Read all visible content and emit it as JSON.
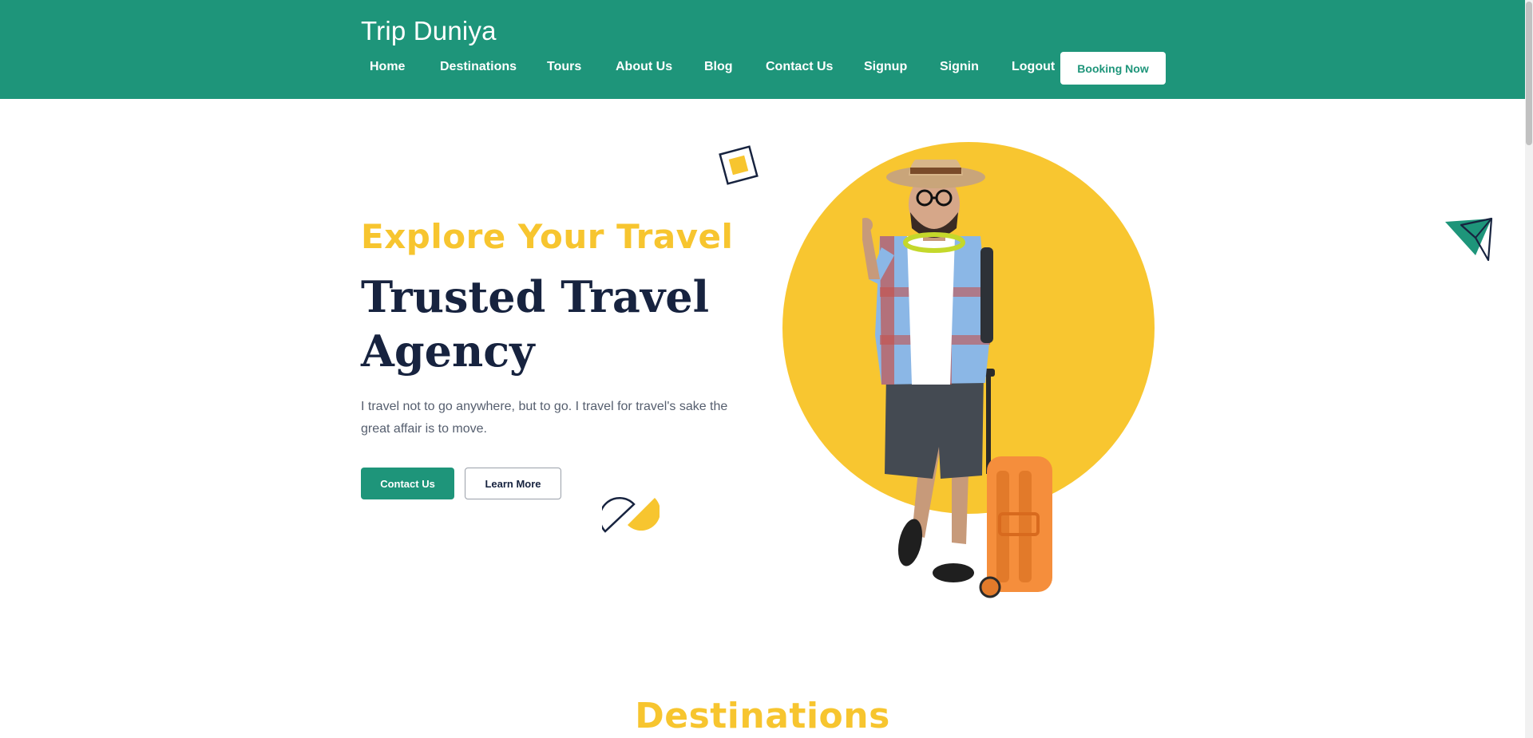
{
  "brand": {
    "name": "Trip Duniya"
  },
  "nav": {
    "items": [
      "Home",
      "Destinations",
      "Tours",
      "About Us",
      "Blog",
      "Contact Us",
      "Signup",
      "Signin",
      "Logout"
    ],
    "cta_label": "Booking Now"
  },
  "hero": {
    "subtitle": "Explore Your Travel",
    "title_line1": "Trusted Travel",
    "title_line2": "Agency",
    "description": "I travel not to go anywhere, but to go. I travel for travel's sake the great affair is to move.",
    "primary_button": "Contact Us",
    "secondary_button": "Learn More"
  },
  "sections": {
    "destinations_title": "Destinations"
  },
  "colors": {
    "primary": "#1e957a",
    "accent": "#f7c52f",
    "heading": "#17233f",
    "text": "#555e6e"
  },
  "icons": [
    "square-decoration-icon",
    "half-circle-decoration-icon",
    "paper-plane-icon"
  ]
}
